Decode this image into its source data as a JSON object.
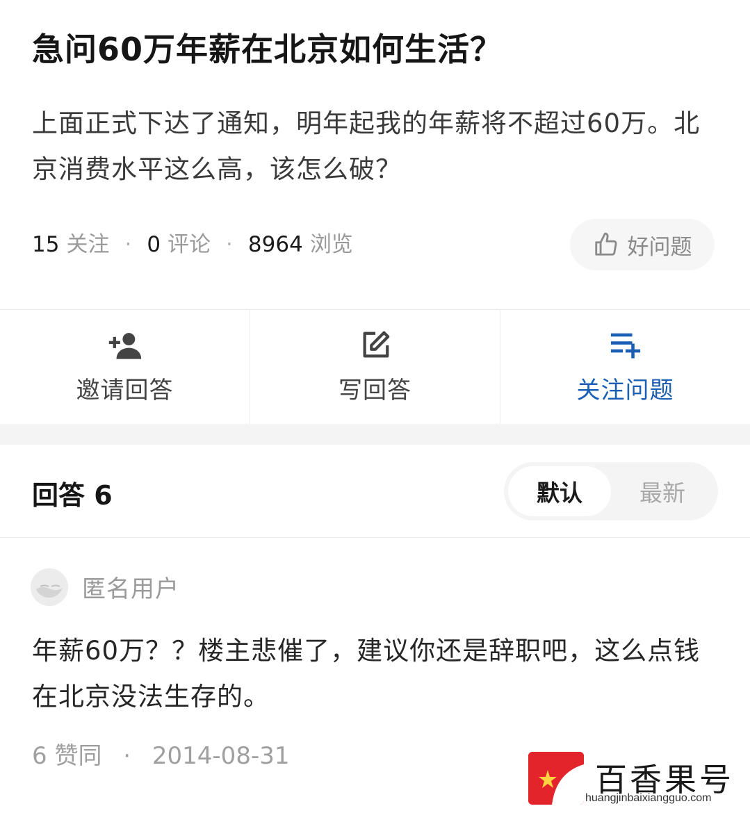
{
  "question": {
    "title": "急问60万年薪在北京如何生活？",
    "body": "上面正式下达了通知，明年起我的年薪将不超过60万。北京消费水平这么高，该怎么破？",
    "stats": [
      {
        "num": "15",
        "label": "关注"
      },
      {
        "num": "0",
        "label": "评论"
      },
      {
        "num": "8964",
        "label": "浏览"
      }
    ],
    "separator": "·",
    "good_question": {
      "label": "好问题",
      "icon": "thumbs-up-icon"
    }
  },
  "actions": [
    {
      "label": "邀请回答",
      "icon": "add-person-icon"
    },
    {
      "label": "写回答",
      "icon": "edit-icon"
    },
    {
      "label": "关注问题",
      "icon": "list-add-icon",
      "color": "#1a5fb4"
    }
  ],
  "answers_header": {
    "title": "回答 6",
    "sort_options": [
      {
        "label": "默认",
        "active": true
      },
      {
        "label": "最新",
        "active": false
      }
    ]
  },
  "answer": {
    "author": "匿名用户",
    "body": "年薪60万？？楼主悲催了，建议你还是辞职吧，这么点钱在北京没法生存的。",
    "agree": "6 赞同",
    "separator": "·",
    "date": "2014-08-31"
  },
  "watermark": {
    "name": "百香果号",
    "url": "huangjinbaixiangguo.com",
    "color": "#e3242b"
  }
}
